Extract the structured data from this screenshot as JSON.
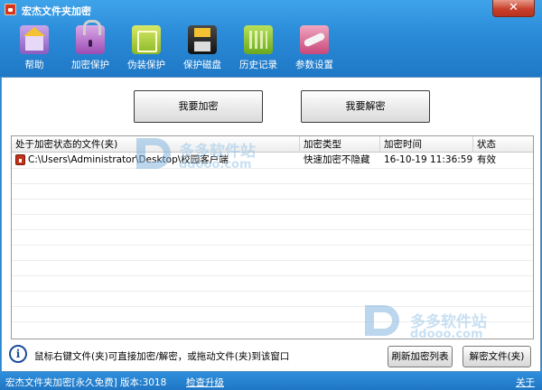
{
  "window": {
    "title": "宏杰文件夹加密",
    "close_label": "✕"
  },
  "toolbar": {
    "items": [
      {
        "label": "帮助",
        "icon": "house-icon"
      },
      {
        "label": "加密保护",
        "icon": "lock-icon"
      },
      {
        "label": "伪装保护",
        "icon": "book-icon"
      },
      {
        "label": "保护磁盘",
        "icon": "disk-icon"
      },
      {
        "label": "历史记录",
        "icon": "history-icon"
      },
      {
        "label": "参数设置",
        "icon": "wrench-icon"
      }
    ]
  },
  "actions": {
    "encrypt_label": "我要加密",
    "decrypt_label": "我要解密"
  },
  "table": {
    "columns": [
      "处于加密状态的文件(夹)",
      "加密类型",
      "加密时间",
      "状态"
    ],
    "rows": [
      {
        "path": "C:\\Users\\Administrator\\Desktop\\校园客户端",
        "type": "快速加密不隐藏",
        "time": "16-10-19 11:36:59",
        "status": "有效"
      }
    ]
  },
  "watermark": {
    "text": "多多软件站",
    "url": "ddooo.com"
  },
  "footer": {
    "info_icon": "i",
    "hint": "鼠标右键文件(夹)可直接加密/解密，或拖动文件(夹)到该窗口",
    "refresh_label": "刷新加密列表",
    "decrypt_file_label": "解密文件(夹)"
  },
  "statusbar": {
    "product": "宏杰文件夹加密[永久免费]  版本:3018",
    "check_update": "检查升级",
    "about": "关于"
  }
}
